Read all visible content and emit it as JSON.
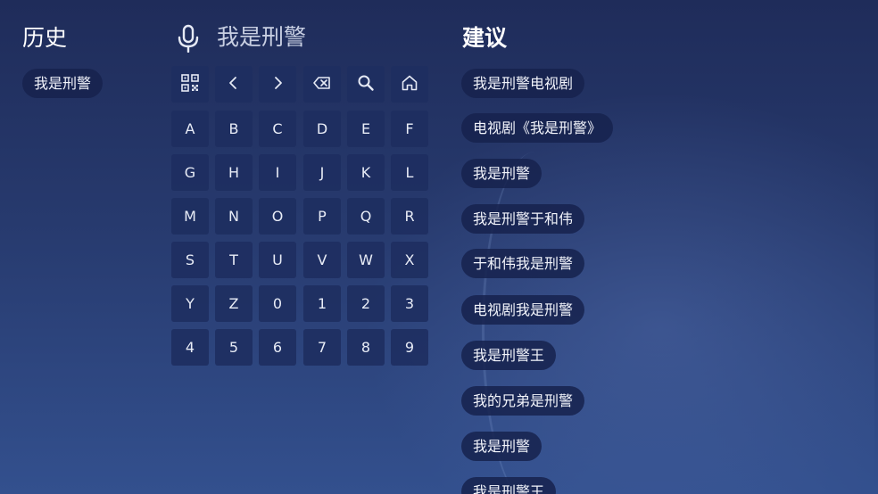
{
  "history": {
    "title": "历史",
    "items": [
      "我是刑警"
    ]
  },
  "search": {
    "query": "我是刑警"
  },
  "keyboard": {
    "function_keys": [
      {
        "name": "qr-code",
        "icon": "qr-code-icon"
      },
      {
        "name": "cursor-left",
        "icon": "chevron-left-icon"
      },
      {
        "name": "cursor-right",
        "icon": "chevron-right-icon"
      },
      {
        "name": "backspace",
        "icon": "backspace-icon"
      },
      {
        "name": "search",
        "icon": "search-icon"
      },
      {
        "name": "home",
        "icon": "home-icon"
      }
    ],
    "rows": [
      [
        "A",
        "B",
        "C",
        "D",
        "E",
        "F"
      ],
      [
        "G",
        "H",
        "I",
        "J",
        "K",
        "L"
      ],
      [
        "M",
        "N",
        "O",
        "P",
        "Q",
        "R"
      ],
      [
        "S",
        "T",
        "U",
        "V",
        "W",
        "X"
      ],
      [
        "Y",
        "Z",
        "0",
        "1",
        "2",
        "3"
      ],
      [
        "4",
        "5",
        "6",
        "7",
        "8",
        "9"
      ]
    ]
  },
  "suggestions": {
    "title": "建议",
    "items": [
      "我是刑警电视剧",
      "电视剧《我是刑警》",
      "我是刑警",
      "我是刑警于和伟",
      "于和伟我是刑警",
      "电视剧我是刑警",
      "我是刑警王",
      "我的兄弟是刑警",
      "我是刑警",
      "我是刑警王"
    ]
  }
}
